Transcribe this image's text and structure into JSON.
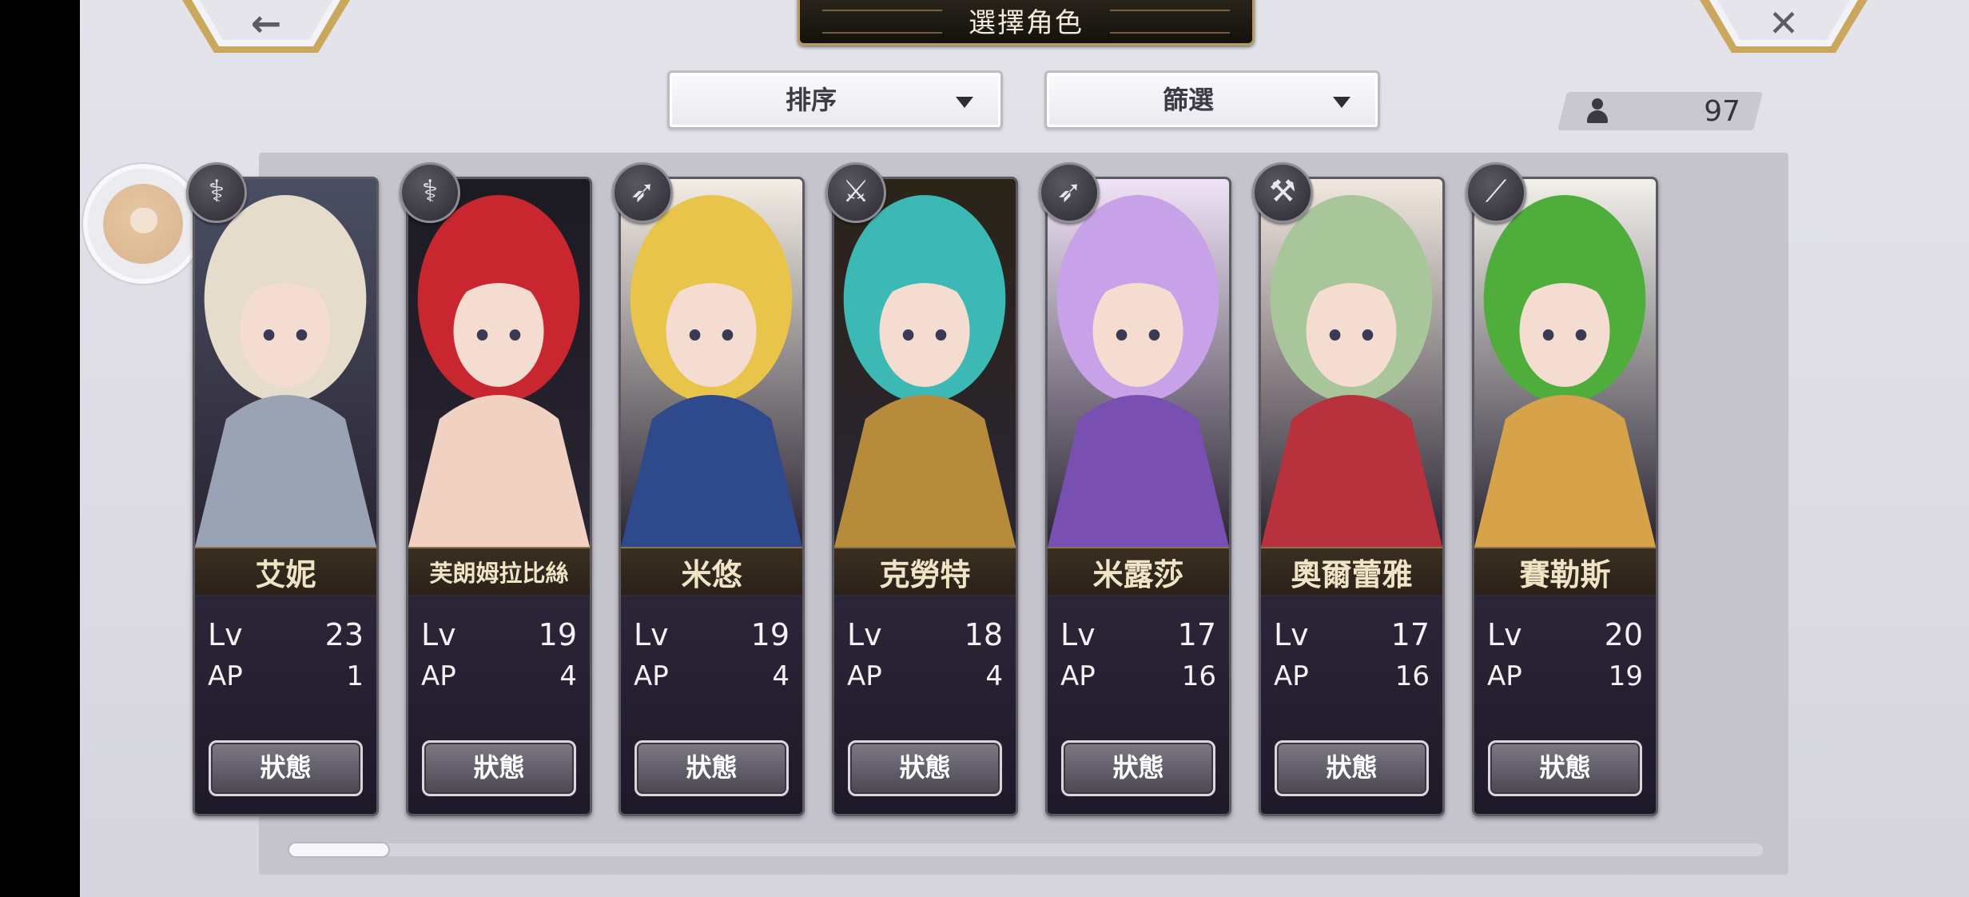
{
  "header": {
    "title": "選擇角色",
    "back_glyph": "←",
    "close_glyph": "✕"
  },
  "toolbar": {
    "sort_label": "排序",
    "filter_label": "篩選",
    "character_count": "97"
  },
  "characters": [
    {
      "name": "艾妮",
      "level_label": "Lv",
      "level": "23",
      "ap_label": "AP",
      "ap": "1",
      "status_label": "狀態",
      "weapon": "staff-icon",
      "weapon_glyph": "⚕",
      "palette": [
        "#e6dccc",
        "#9aa3b4",
        "#4b4f63"
      ]
    },
    {
      "name": "芙朗姆拉比絲",
      "level_label": "Lv",
      "level": "19",
      "ap_label": "AP",
      "ap": "4",
      "status_label": "狀態",
      "weapon": "staff-icon",
      "weapon_glyph": "⚕",
      "palette": [
        "#c9272f",
        "#f1d2c2",
        "#1c1a22"
      ]
    },
    {
      "name": "米悠",
      "level_label": "Lv",
      "level": "19",
      "ap_label": "AP",
      "ap": "4",
      "status_label": "狀態",
      "weapon": "spear-icon",
      "weapon_glyph": "➶",
      "palette": [
        "#e8c44a",
        "#2e4a8c",
        "#f3ede4"
      ]
    },
    {
      "name": "克勞特",
      "level_label": "Lv",
      "level": "18",
      "ap_label": "AP",
      "ap": "4",
      "status_label": "狀態",
      "weapon": "sword-icon",
      "weapon_glyph": "⚔",
      "palette": [
        "#3cb9b5",
        "#b78b3c",
        "#2b2418"
      ]
    },
    {
      "name": "米露莎",
      "level_label": "Lv",
      "level": "17",
      "ap_label": "AP",
      "ap": "16",
      "status_label": "狀態",
      "weapon": "spear-icon",
      "weapon_glyph": "➶",
      "palette": [
        "#c7a2e8",
        "#7a4fb2",
        "#f0e3f6"
      ]
    },
    {
      "name": "奧爾蕾雅",
      "level_label": "Lv",
      "level": "17",
      "ap_label": "AP",
      "ap": "16",
      "status_label": "狀態",
      "weapon": "axe-icon",
      "weapon_glyph": "⚒",
      "palette": [
        "#a9c59a",
        "#b8323d",
        "#f1e8df"
      ]
    },
    {
      "name": "賽勒斯",
      "level_label": "Lv",
      "level": "20",
      "ap_label": "AP",
      "ap": "19",
      "status_label": "狀態",
      "weapon": "katana-icon",
      "weapon_glyph": "⟋",
      "palette": [
        "#4fae3b",
        "#d6a24a",
        "#f2f0ea"
      ]
    }
  ],
  "colors": {
    "panel": "#c5c3cc",
    "name_band": "#2a2118",
    "accent_gold": "#b89a5a"
  }
}
